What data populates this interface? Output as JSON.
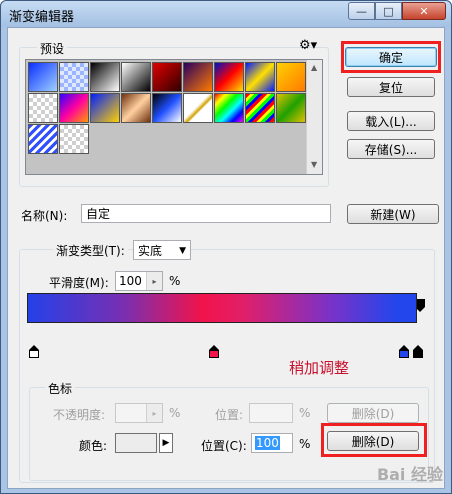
{
  "window": {
    "title": "渐变编辑器",
    "controls": {
      "minimize": "—",
      "maximize": "□",
      "close": "✕"
    }
  },
  "presets": {
    "label": "预设",
    "menu_icon": "gear-icon",
    "swatches": [
      "linear-gradient(135deg,#0a2fff,#9fd0ff)",
      "repeating-conic-gradient(#9bb6ff 0 25%,#dfe8ff 0 50%) 0 0/8px 8px",
      "linear-gradient(135deg,#000,#fff)",
      "linear-gradient(135deg,#fff,#000)",
      "linear-gradient(135deg,#e00000,#300000)",
      "linear-gradient(135deg,#2a0060,#ff7a00)",
      "linear-gradient(135deg,#0010c0,#ff0000,#ffe000)",
      "linear-gradient(135deg,#001aff,#ffe000,#001aff)",
      "linear-gradient(135deg,#ffd000,#ff7a00)",
      "repeating-conic-gradient(#cfcfcf 0 25%,#fff 0 50%) 0 0/8px 8px",
      "linear-gradient(135deg,#3000ff,#ff00a0,#ff9a00)",
      "linear-gradient(135deg,#0020ff,#ffd000)",
      "linear-gradient(135deg,#703010,#ffd0a0,#703010)",
      "linear-gradient(135deg,#000,#2050ff,#fff)",
      "linear-gradient(135deg,#fff 0%,#fff 45%,#d0a000 55%,#fff 60%)",
      "linear-gradient(135deg,#ff0000,#ffff00,#00ff00,#00ffff,#0000ff,#ff00ff)",
      "repeating-linear-gradient(135deg,#ff0000 0 3px,#ffff00 3px 6px,#00ff00 6px 9px,#0000ff 9px 12px)",
      "linear-gradient(135deg,#e0c000,#20a000,#e0c000)",
      "repeating-linear-gradient(135deg,#3050ff 0 3px,#fff 3px 6px)",
      "repeating-conic-gradient(#cfcfcf 0 25%,#fff 0 50%) 0 0/8px 8px"
    ]
  },
  "buttons": {
    "ok": "确定",
    "reset": "复位",
    "load": "载入(L)...",
    "save": "存储(S)...",
    "new": "新建(W)",
    "delete_opacity": "删除(D)",
    "delete_color": "删除(D)"
  },
  "name_field": {
    "label": "名称(N):",
    "value": "自定"
  },
  "gradient_type": {
    "label": "渐变类型(T):",
    "value": "实底"
  },
  "smoothness": {
    "label": "平滑度(M):",
    "value": "100",
    "unit": "%"
  },
  "annotation": "稍加调整",
  "stops": {
    "group_label": "色标",
    "opacity_label": "不透明度:",
    "opacity_unit": "%",
    "opacity_location_label": "位置:",
    "opacity_location_unit": "%",
    "color_label": "颜色:",
    "color_location_label": "位置(C):",
    "color_location_value": "100",
    "color_location_unit": "%",
    "color_stop_colors": [
      "#ffffff",
      "#f2134a",
      "#2346ec",
      "#000000"
    ]
  },
  "watermark": "Bai 经验"
}
